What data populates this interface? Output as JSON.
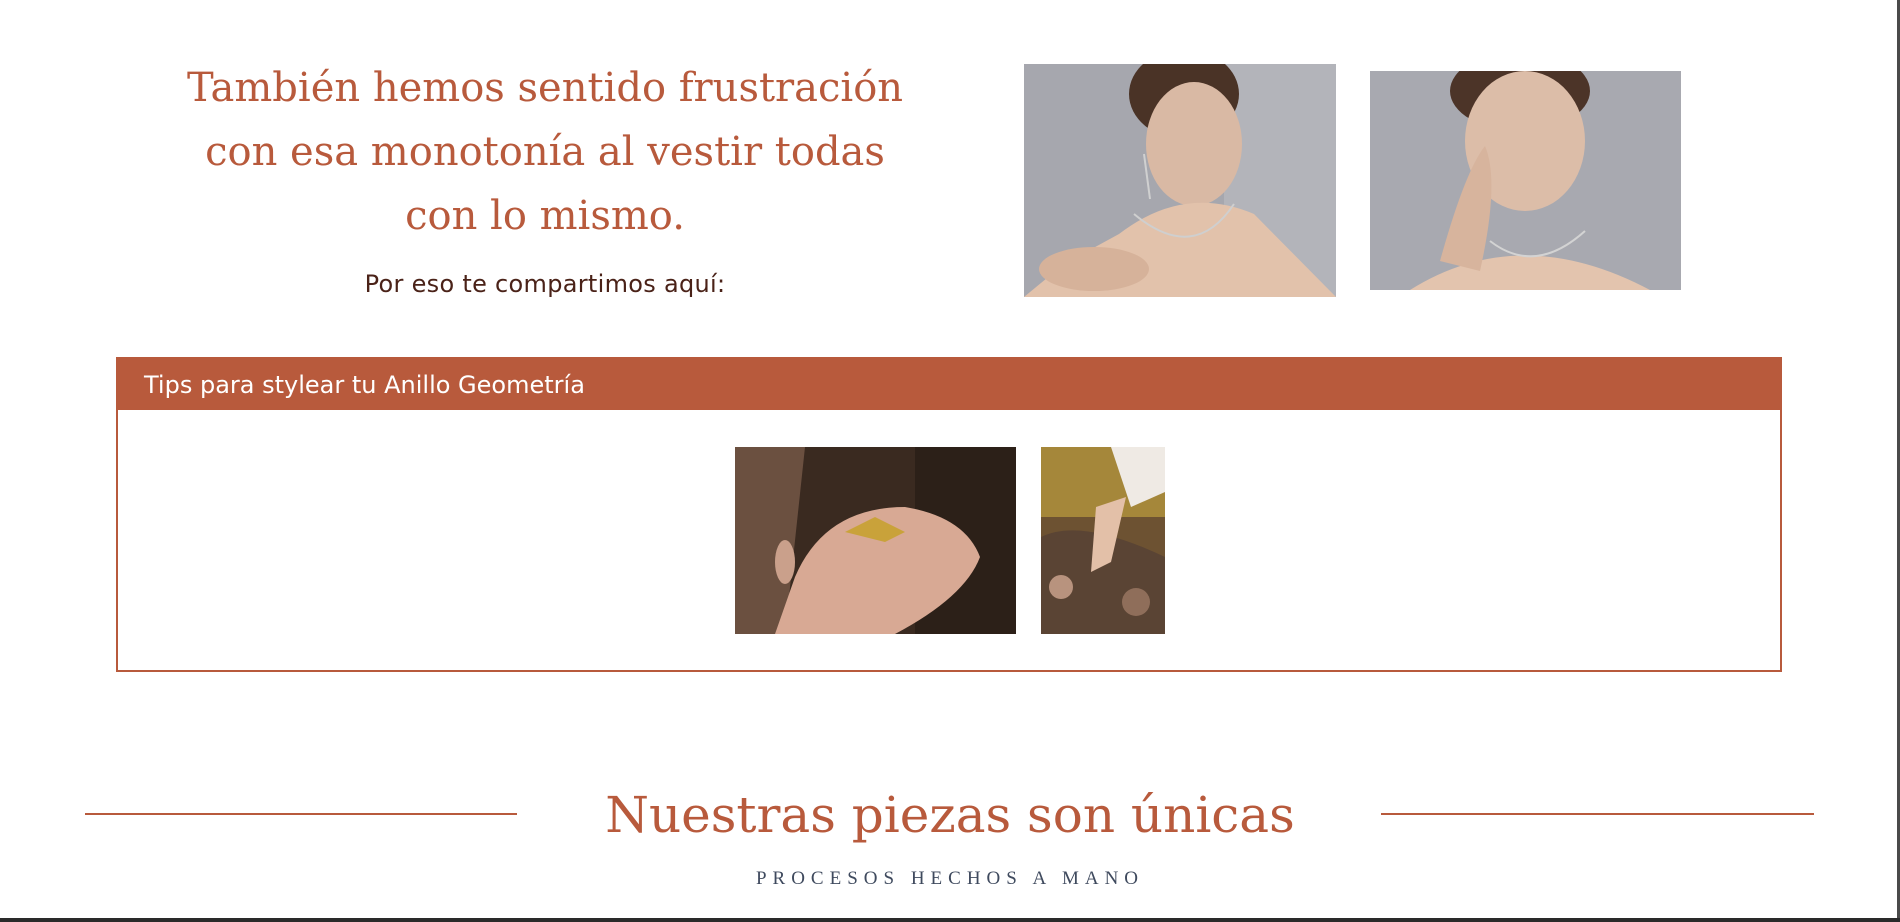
{
  "hero": {
    "heading": "También hemos sentido frustración con esa monotonía al vestir todas con lo mismo.",
    "subheading": "Por eso te compartimos aquí:"
  },
  "tips": {
    "title": "Tips para stylear tu Anillo Geometría"
  },
  "section": {
    "title": "Nuestras piezas son únicas",
    "subtitle": "PROCESOS HECHOS A MANO"
  },
  "colors": {
    "accent": "#b85a3c",
    "heading_dark": "#4a2218",
    "subtitle": "#3f4a5e",
    "photo_background": "#a9aab0"
  },
  "images": {
    "model_photo_1": "woman-necklace-photo",
    "model_photo_2": "woman-hand-necklace-photo",
    "tip_photo_1": "hand-gold-ring-photo",
    "tip_photo_2": "hand-rings-leaves-photo"
  }
}
